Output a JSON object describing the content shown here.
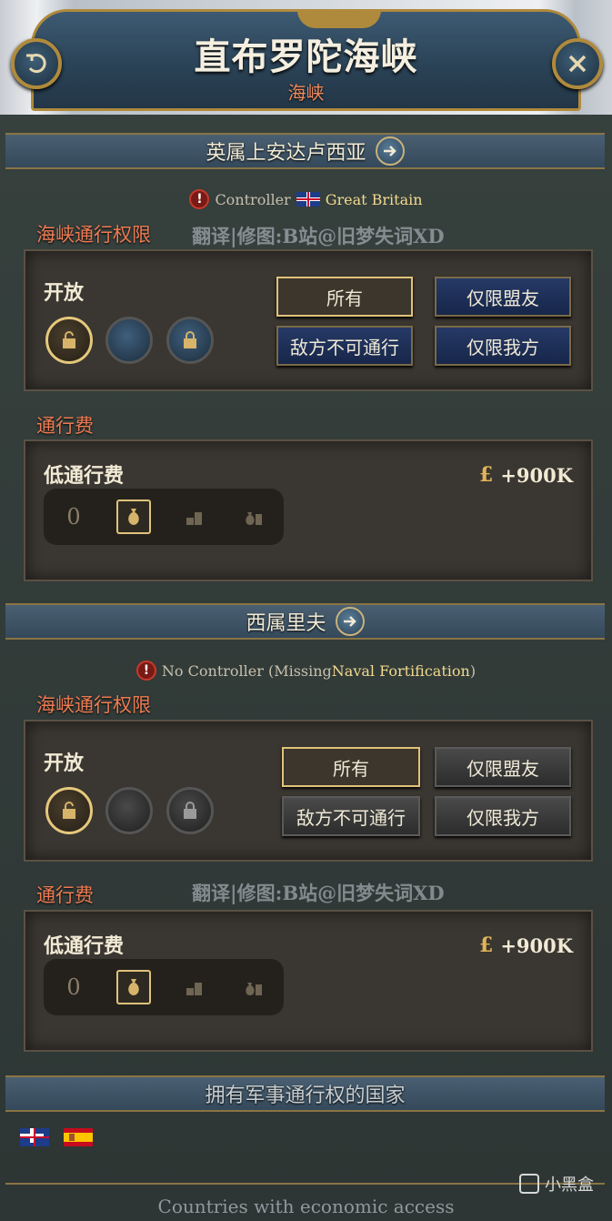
{
  "header": {
    "title": "直布罗陀海峡",
    "subtitle": "海峡",
    "back_icon": "back-arrow-icon",
    "close_icon": "close-icon"
  },
  "sections": [
    {
      "banner": "英属上安达卢西亚",
      "controller_label": "Controller",
      "controller_name": "Great Britain",
      "access_label": "海峡通行权限",
      "access_state": "开放",
      "options": [
        "所有",
        "仅限盟友",
        "敌方不可通行",
        "仅限我方"
      ],
      "selected_option": "所有",
      "toll_label": "通行费",
      "toll_state": "低通行费",
      "toll_value": "+900K",
      "toll_zero": "0"
    },
    {
      "banner": "西属里夫",
      "controller_label": "No Controller (Missing ",
      "controller_name": "Naval Fortification",
      "controller_suffix": ")",
      "access_label": "海峡通行权限",
      "access_state": "开放",
      "options": [
        "所有",
        "仅限盟友",
        "敌方不可通行",
        "仅限我方"
      ],
      "selected_option": "所有",
      "toll_label": "通行费",
      "toll_state": "低通行费",
      "toll_value": "+900K",
      "toll_zero": "0"
    }
  ],
  "watermark": "翻译|修图:B站@旧梦失词XD",
  "military_access": {
    "title": "拥有军事通行权的国家",
    "countries": [
      "Great Britain flag",
      "Spain flag"
    ]
  },
  "economic_access_title": "Countries with economic access",
  "brand_text": "小黑盒",
  "colors": {
    "accent_orange": "#ee7b52",
    "gold_border": "#b08a3c",
    "button_blue": "#263a66"
  }
}
